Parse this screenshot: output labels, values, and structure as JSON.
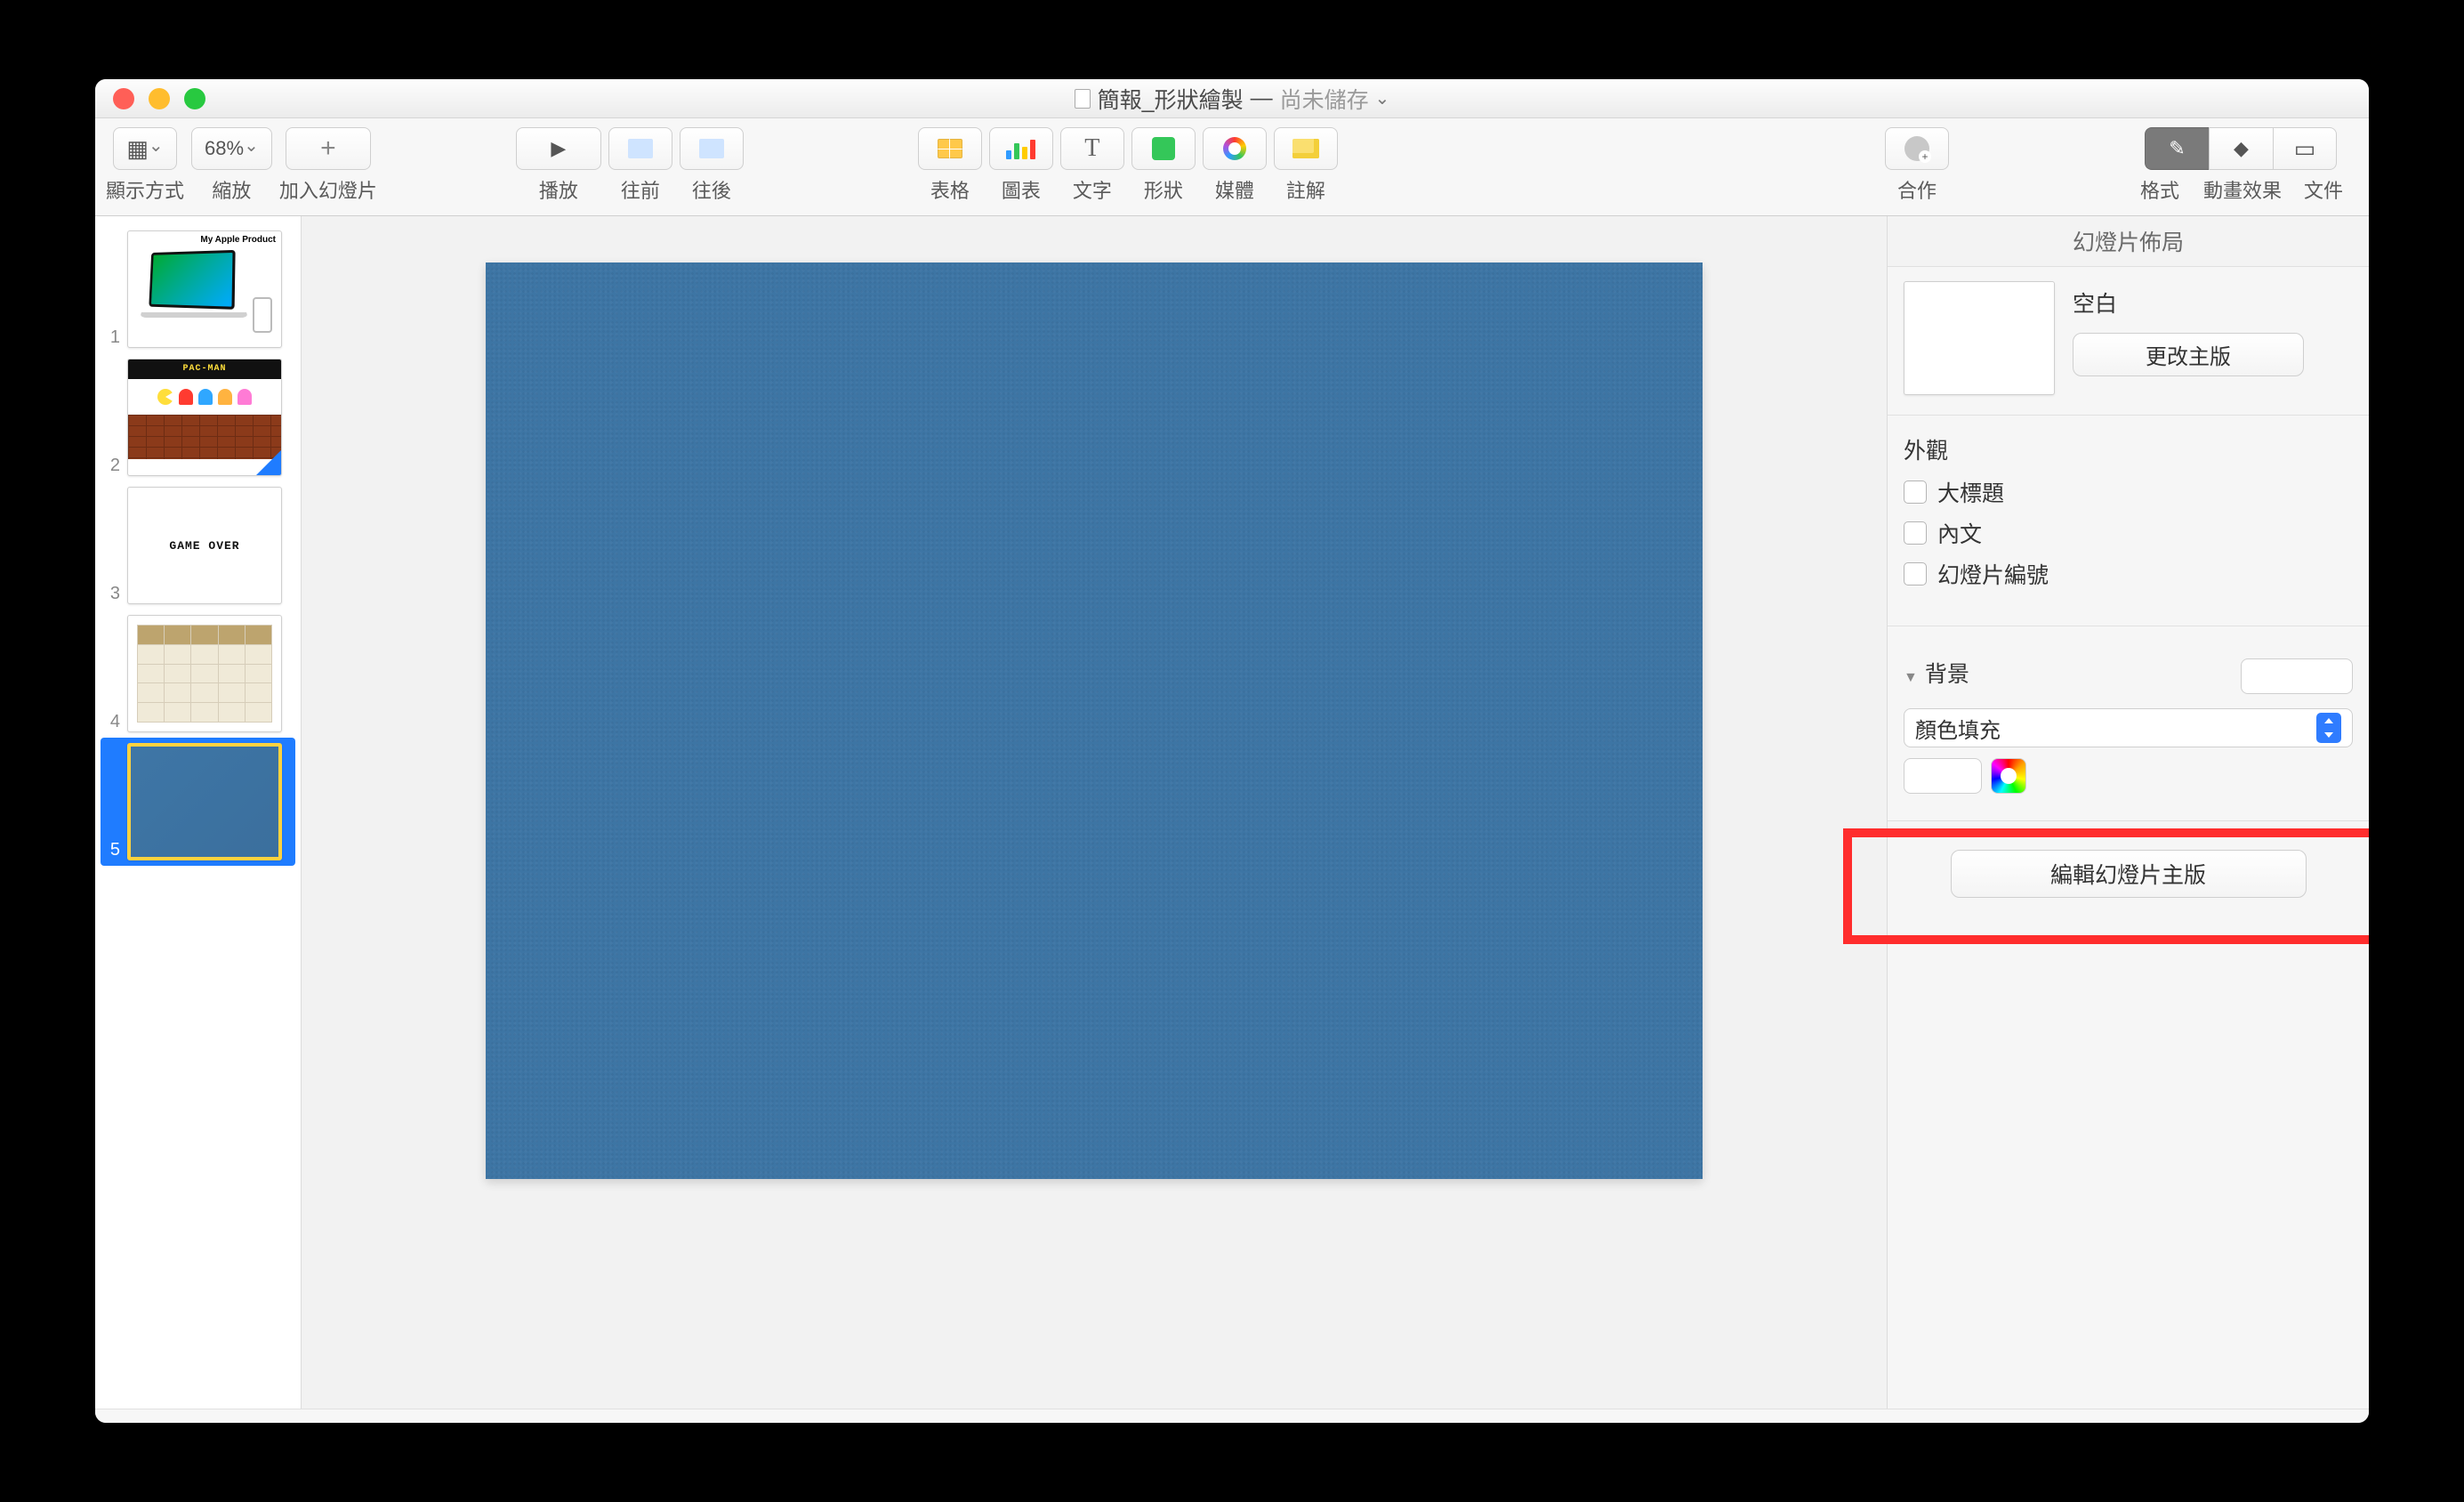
{
  "title": {
    "name": "簡報_形狀繪製",
    "sep": " — ",
    "save_state": "尚未儲存"
  },
  "toolbar": {
    "view_label": "顯示方式",
    "zoom_value": "68%",
    "zoom_label": "縮放",
    "add_slide_label": "加入幻燈片",
    "play_label": "播放",
    "prev_label": "往前",
    "next_label": "往後",
    "table_label": "表格",
    "chart_label": "圖表",
    "text_label": "文字",
    "shape_label": "形狀",
    "media_label": "媒體",
    "comment_label": "註解",
    "collab_label": "合作",
    "format_label": "格式",
    "animate_label": "動畫效果",
    "document_label": "文件"
  },
  "thumbnails": {
    "slide1_title": "My Apple Product",
    "slide2_banner": "PAC-MAN",
    "slide3_text": "GAME OVER",
    "selected_index": 5
  },
  "inspector": {
    "header": "幻燈片佈局",
    "layout_name": "空白",
    "change_master_btn": "更改主版",
    "appearance_heading": "外觀",
    "chk_title": "大標題",
    "chk_body": "內文",
    "chk_number": "幻燈片編號",
    "background_heading": "背景",
    "fill_select": "顏色填充",
    "edit_master_btn": "編輯幻燈片主版"
  }
}
